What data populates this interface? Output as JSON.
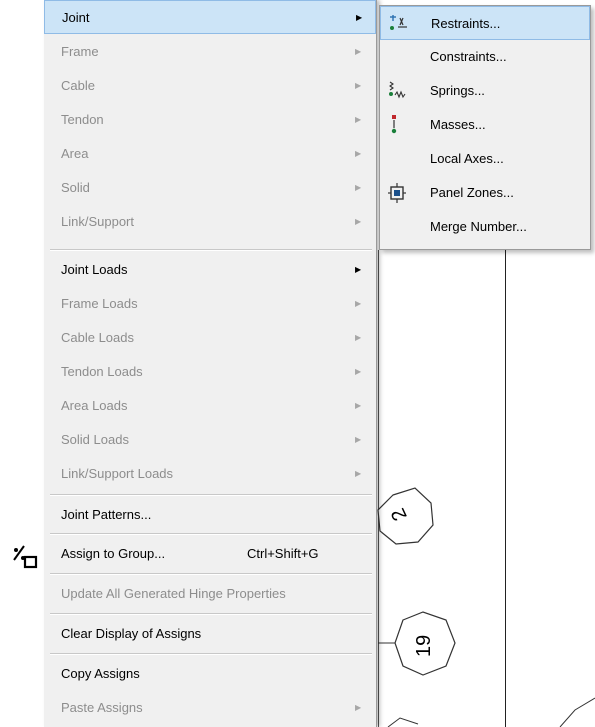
{
  "menu": {
    "items": [
      {
        "label": "Joint",
        "state": "highlighted",
        "submenu": true
      },
      {
        "label": "Frame",
        "state": "disabled",
        "submenu": true
      },
      {
        "label": "Cable",
        "state": "disabled",
        "submenu": true
      },
      {
        "label": "Tendon",
        "state": "disabled",
        "submenu": true
      },
      {
        "label": "Area",
        "state": "disabled",
        "submenu": true
      },
      {
        "label": "Solid",
        "state": "disabled",
        "submenu": true
      },
      {
        "label": "Link/Support",
        "state": "disabled",
        "submenu": true
      },
      {
        "label": "Joint Loads",
        "state": "enabled",
        "submenu": true
      },
      {
        "label": "Frame Loads",
        "state": "disabled",
        "submenu": true
      },
      {
        "label": "Cable Loads",
        "state": "disabled",
        "submenu": true
      },
      {
        "label": "Tendon Loads",
        "state": "disabled",
        "submenu": true
      },
      {
        "label": "Area Loads",
        "state": "disabled",
        "submenu": true
      },
      {
        "label": "Solid Loads",
        "state": "disabled",
        "submenu": true
      },
      {
        "label": "Link/Support Loads",
        "state": "disabled",
        "submenu": true
      },
      {
        "label": "Joint Patterns...",
        "state": "enabled",
        "submenu": false
      },
      {
        "label": "Assign to Group...",
        "state": "enabled",
        "submenu": false,
        "shortcut": "Ctrl+Shift+G"
      },
      {
        "label": "Update All Generated Hinge Properties",
        "state": "disabled",
        "submenu": false
      },
      {
        "label": "Clear Display of Assigns",
        "state": "enabled",
        "submenu": false
      },
      {
        "label": "Copy Assigns",
        "state": "enabled",
        "submenu": false
      },
      {
        "label": "Paste Assigns",
        "state": "disabled",
        "submenu": true
      }
    ]
  },
  "submenu": {
    "items": [
      {
        "label": "Restraints...",
        "icon": "restraints-icon",
        "state": "highlighted"
      },
      {
        "label": "Constraints...",
        "icon": "",
        "state": "enabled"
      },
      {
        "label": "Springs...",
        "icon": "springs-icon",
        "state": "enabled"
      },
      {
        "label": "Masses...",
        "icon": "masses-icon",
        "state": "enabled"
      },
      {
        "label": "Local Axes...",
        "icon": "",
        "state": "enabled"
      },
      {
        "label": "Panel Zones...",
        "icon": "panel-zones-icon",
        "state": "enabled"
      },
      {
        "label": "Merge Number...",
        "icon": "",
        "state": "enabled"
      }
    ]
  },
  "canvas": {
    "node_labels": [
      "2",
      "19"
    ]
  },
  "colors": {
    "menu_bg": "#f0f0f0",
    "highlight": "#cce4f7",
    "disabled_text": "#8d8d8d"
  }
}
